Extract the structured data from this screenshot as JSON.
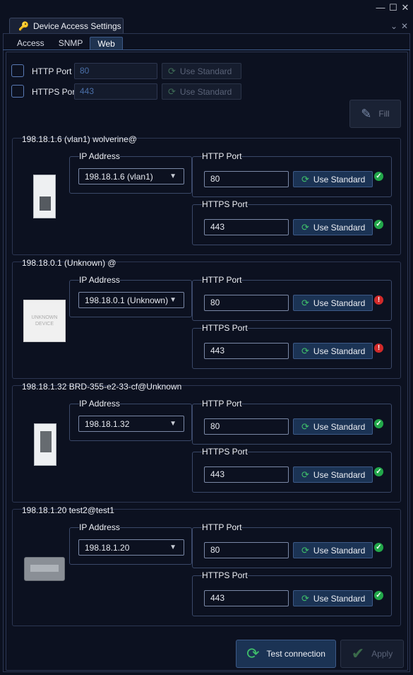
{
  "window": {
    "controls": {
      "minimize": "—",
      "maximize": "☐",
      "close": "✕"
    }
  },
  "doc_tab": {
    "title": "Device Access Settings",
    "icon": "key-icon"
  },
  "sub_tabs": [
    {
      "label": "Access"
    },
    {
      "label": "SNMP"
    },
    {
      "label": "Web",
      "active": true
    }
  ],
  "global": {
    "http": {
      "label": "HTTP Port",
      "value": "80",
      "button": "Use Standard"
    },
    "https": {
      "label": "HTTPS Port",
      "value": "443",
      "button": "Use Standard"
    },
    "fill_label": "Fill"
  },
  "devices": [
    {
      "title": "198.18.1.6 (vlan1) wolverine@",
      "ip_label": "IP Address",
      "ip_value": "198.18.1.6 (vlan1)",
      "http_label": "HTTP Port",
      "http_value": "80",
      "http_status": "ok",
      "https_label": "HTTPS Port",
      "https_value": "443",
      "https_status": "ok",
      "use_standard": "Use Standard"
    },
    {
      "title": "198.18.0.1 (Unknown) @",
      "ip_label": "IP Address",
      "ip_value": "198.18.0.1 (Unknown)",
      "image_text": "UNKNOWN DEVICE",
      "http_label": "HTTP Port",
      "http_value": "80",
      "http_status": "error",
      "https_label": "HTTPS Port",
      "https_value": "443",
      "https_status": "error",
      "use_standard": "Use Standard"
    },
    {
      "title": "198.18.1.32 BRD-355-e2-33-cf@Unknown",
      "ip_label": "IP Address",
      "ip_value": "198.18.1.32",
      "http_label": "HTTP Port",
      "http_value": "80",
      "http_status": "ok",
      "https_label": "HTTPS Port",
      "https_value": "443",
      "https_status": "ok",
      "use_standard": "Use Standard"
    },
    {
      "title": "198.18.1.20 test2@test1",
      "ip_label": "IP Address",
      "ip_value": "198.18.1.20",
      "http_label": "HTTP Port",
      "http_value": "80",
      "http_status": "ok",
      "https_label": "HTTPS Port",
      "https_value": "443",
      "https_status": "ok",
      "use_standard": "Use Standard"
    }
  ],
  "footer": {
    "test_label": "Test connection",
    "apply_label": "Apply"
  },
  "colors": {
    "background": "#0c1120",
    "accent": "#1b3354",
    "ok": "#22a84a",
    "error": "#d12a2a"
  }
}
